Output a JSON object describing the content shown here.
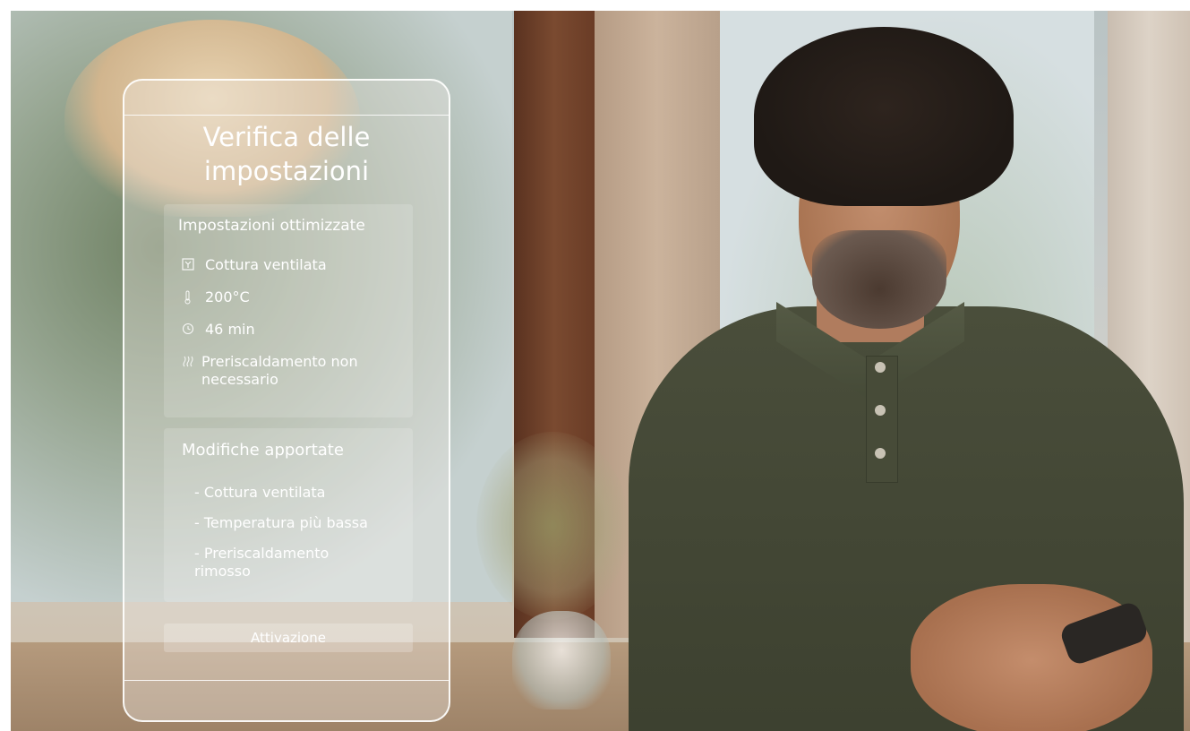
{
  "screen": {
    "title": "Verifica delle impostazioni",
    "optimized": {
      "heading": "Impostazioni ottimizzate",
      "items": [
        {
          "icon": "fan-icon",
          "label": "Cottura ventilata"
        },
        {
          "icon": "thermometer-icon",
          "label": "200°C"
        },
        {
          "icon": "clock-icon",
          "label": "46 min"
        },
        {
          "icon": "heat-waves-icon",
          "label": "Preriscaldamento non necessario"
        }
      ]
    },
    "changes": {
      "heading": "Modifiche apportate",
      "items": [
        "- Cottura ventilata",
        "- Temperatura più bassa",
        "- Preriscaldamento rimosso"
      ]
    },
    "action_label": "Attivazione"
  }
}
